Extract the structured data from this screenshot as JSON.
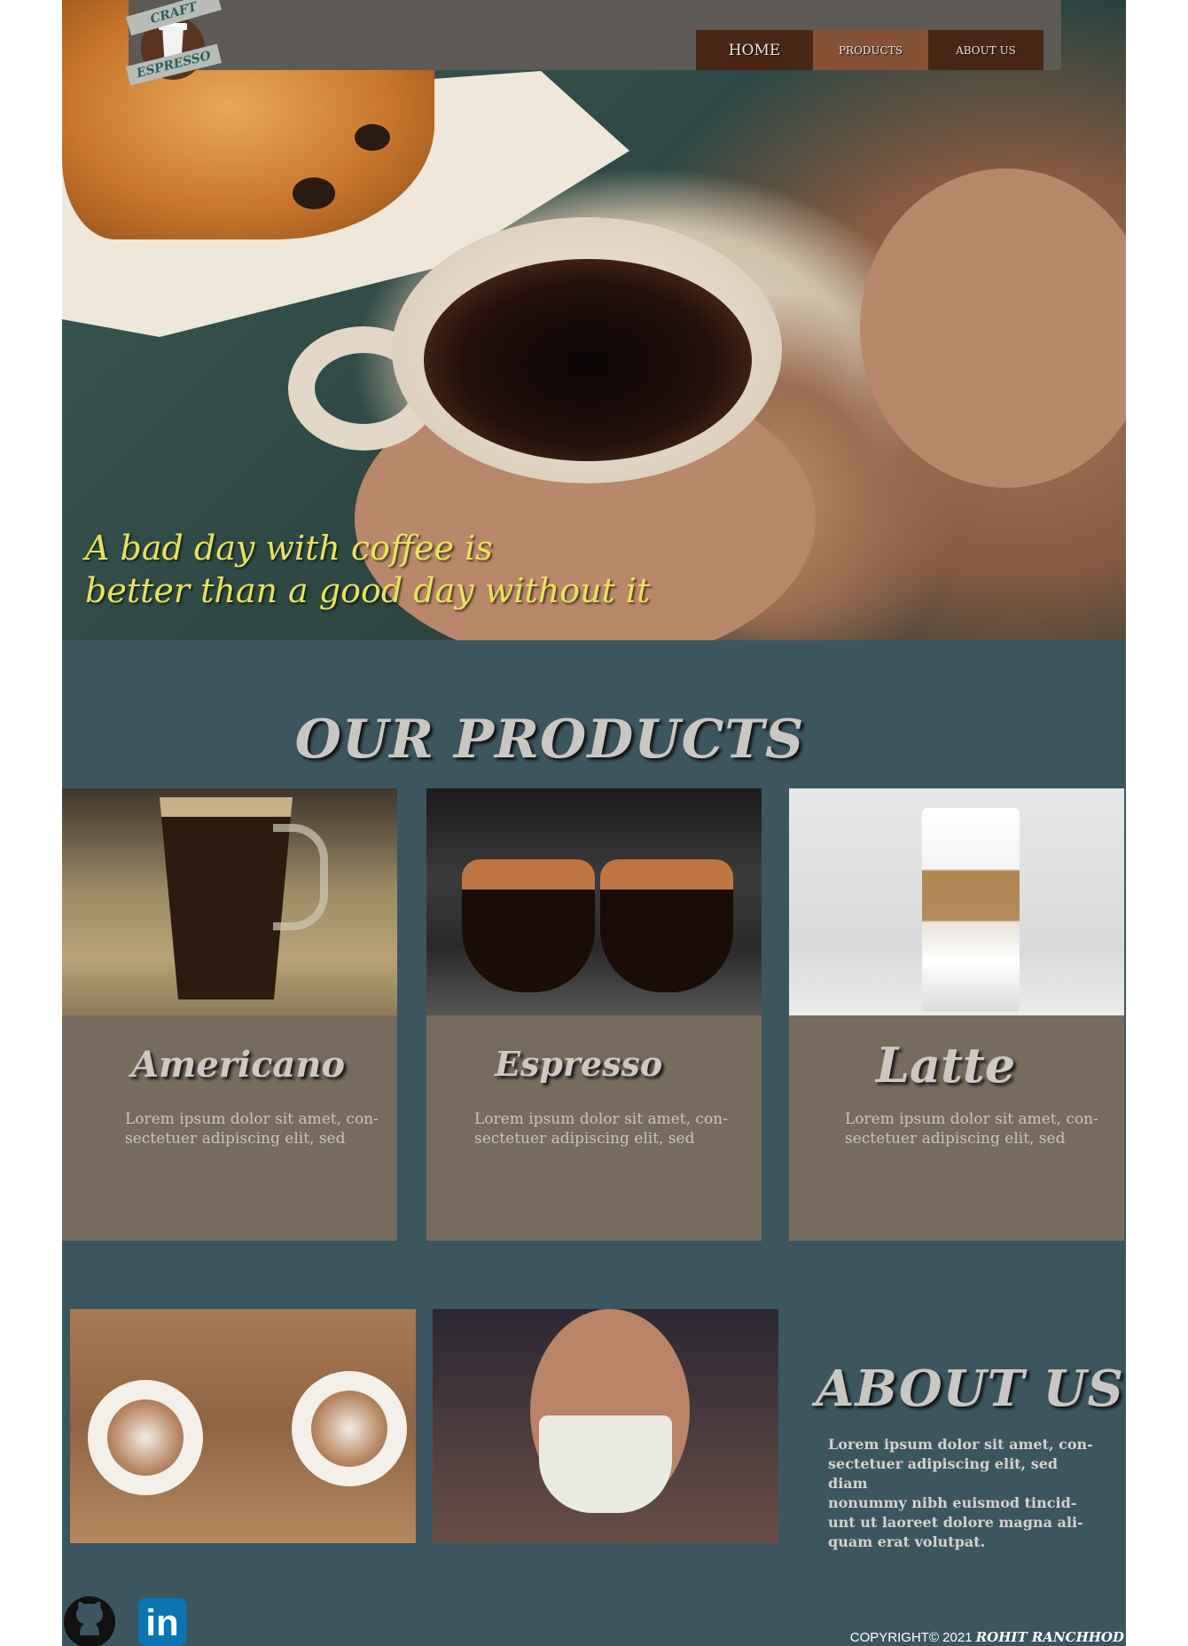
{
  "logo": {
    "top_text": "CRAFT",
    "bottom_text": "ESPRESSO"
  },
  "nav": {
    "home": "HOME",
    "products": "PRODUCTS",
    "about": "ABOUT US"
  },
  "hero": {
    "tagline_line1": "A bad  day with coffee is",
    "tagline_line2": "better than a good day without it"
  },
  "products": {
    "title": "OUR PRODUCTS",
    "items": [
      {
        "name": "Americano",
        "desc_line1": "Lorem ipsum dolor sit amet, con-",
        "desc_line2": "sectetuer adipiscing elit, sed"
      },
      {
        "name": "Espresso",
        "desc_line1": "Lorem ipsum dolor sit amet, con-",
        "desc_line2": "sectetuer adipiscing elit, sed"
      },
      {
        "name": "Latte",
        "desc_line1": "Lorem ipsum dolor sit amet, con-",
        "desc_line2": "sectetuer adipiscing elit, sed"
      }
    ]
  },
  "about": {
    "title": "ABOUT US",
    "text_lines": [
      "Lorem ipsum dolor sit amet, con-",
      "sectetuer adipiscing elit, sed diam",
      "nonummy nibh euismod tincid-",
      "unt ut laoreet dolore magna ali-",
      "quam erat volutpat."
    ]
  },
  "footer": {
    "copyright": "COPYRIGHT© 2021 ",
    "author": "ROHIT RANCHHOD",
    "icons": [
      "github-icon",
      "linkedin-icon"
    ],
    "linkedin_glyph": "in"
  },
  "colors": {
    "page_bg": "#3c5660",
    "header_bg": "#5e5a55",
    "nav_bg": "#4a2614",
    "nav_active": "#865235",
    "card_bg": "#776b5e",
    "tagline": "#e7e35b"
  }
}
